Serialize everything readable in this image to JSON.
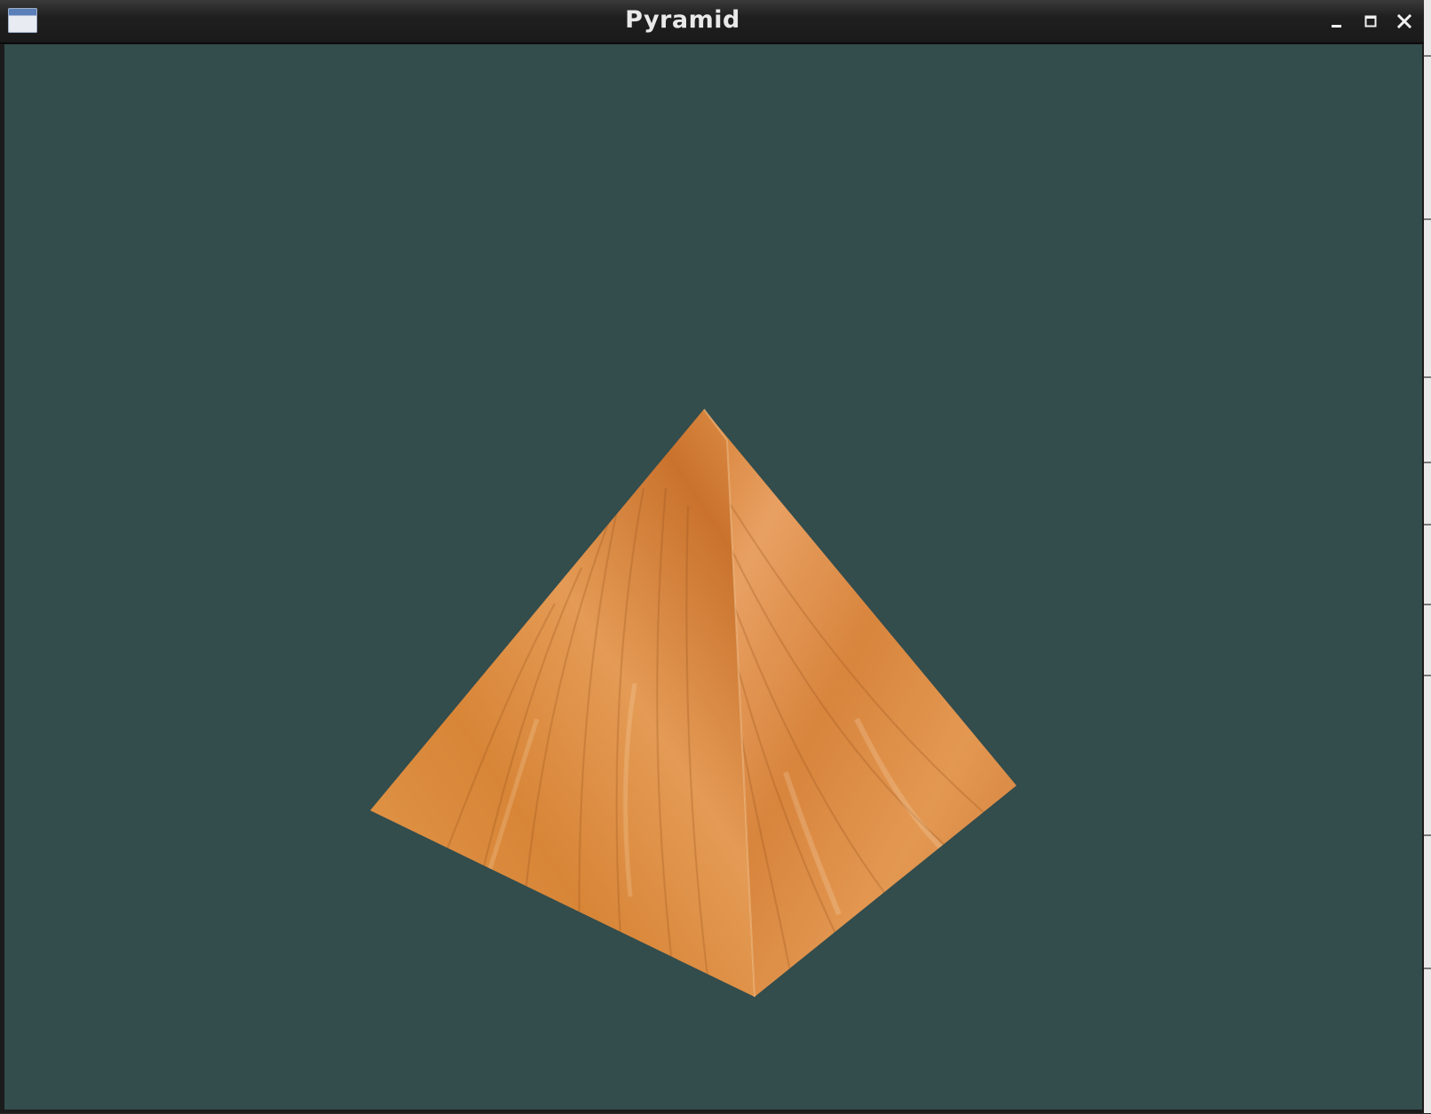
{
  "window": {
    "title": "Pyramid",
    "icons": {
      "app": "app-window-icon",
      "minimize": "minimize-icon",
      "maximize": "maximize-icon",
      "close": "close-icon"
    }
  },
  "scene": {
    "background_color": "#334c4c",
    "object": "textured-pyramid",
    "texture": "wood-texture",
    "face_colors": {
      "left": "#d8873e",
      "right": "#dc8a40"
    }
  }
}
